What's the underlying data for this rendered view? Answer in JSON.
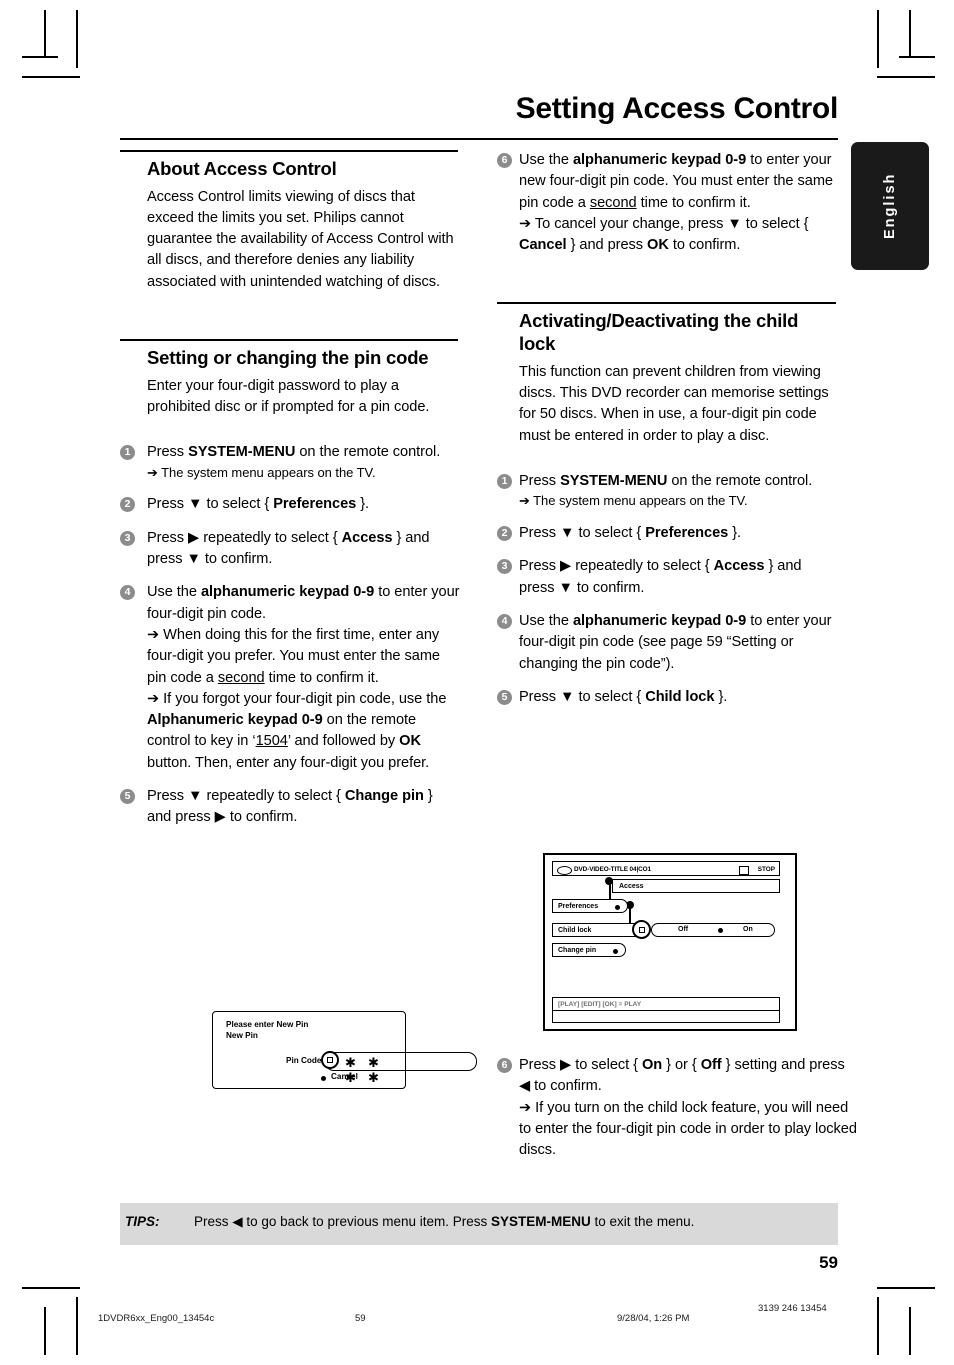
{
  "header": {
    "title": "Setting Access Control",
    "language_tab": "English"
  },
  "left_column": {
    "section1": {
      "heading": "About Access Control",
      "paragraph": "Access Control limits viewing of discs that exceed the limits you set.  Philips cannot guarantee the availability of Access Control with all discs, and therefore denies any liability associated with unintended watching of discs."
    },
    "section2": {
      "heading": "Setting or changing the pin code",
      "paragraph": "Enter your four-digit password to play a prohibited disc or if prompted for a pin code.",
      "steps": [
        {
          "num": "1",
          "main_pre": "Press ",
          "main_bold": "SYSTEM-MENU",
          "main_post": " on the remote control.",
          "sub": "➔ The system menu appears on the TV."
        },
        {
          "num": "2",
          "text_parts": [
            "Press ▼ to select { ",
            "Preferences",
            " }."
          ]
        },
        {
          "num": "3",
          "text_parts": [
            "Press ▶ repeatedly to select { ",
            "Access",
            " } and press ▼  to confirm."
          ]
        },
        {
          "num": "4",
          "main_pre": "Use the ",
          "main_bold": "alphanumeric keypad 0-9",
          "main_post": " to enter your four-digit pin code.",
          "sub1": "➔ When doing this for the first time, enter any four-digit you prefer. You must enter the same pin code a ",
          "sub1_underline": "second",
          "sub1_post": " time to confirm it.",
          "sub2_pre": "➔ If you forgot your four-digit pin code, use the ",
          "sub2_bold1": "Alphanumeric keypad 0-9",
          "sub2_mid": " on the remote control to key in ‘",
          "sub2_underline": "1504",
          "sub2_mid2": "’ and followed by ",
          "sub2_bold2": "OK",
          "sub2_post": " button.  Then, enter any four-digit you prefer."
        },
        {
          "num": "5",
          "text_parts": [
            "Press ▼ repeatedly to select { ",
            "Change pin",
            " } and press ▶  to confirm."
          ]
        }
      ]
    },
    "pin_figure": {
      "line1": "Please enter New Pin",
      "line2": "New Pin",
      "pin_code_label": "Pin Code",
      "stars": "✱ ✱ ✱ ✱",
      "cancel": "Cancel"
    }
  },
  "right_column": {
    "step6_pin": {
      "num": "6",
      "main_pre": "Use the ",
      "main_bold": "alphanumeric keypad 0-9",
      "main_post": " to enter your new four-digit pin code. You must enter the same pin code a ",
      "main_underline": "second",
      "main_post2": " time to confirm it.",
      "sub_pre": "➔ To cancel your change, press ▼ to select { ",
      "sub_bold1": "Cancel",
      "sub_mid": " } and press ",
      "sub_bold2": "OK",
      "sub_post": " to confirm."
    },
    "section3": {
      "heading": "Activating/Deactivating the child lock",
      "paragraph": "This function can prevent children from viewing discs.  This DVD recorder can memorise settings for 50 discs.  When in use, a four-digit pin code must be entered in order to play a disc.",
      "steps": [
        {
          "num": "1",
          "main_pre": "Press ",
          "main_bold": "SYSTEM-MENU",
          "main_post": " on the remote control.",
          "sub": "➔ The system menu appears on the TV."
        },
        {
          "num": "2",
          "text_parts": [
            "Press ▼ to select { ",
            "Preferences",
            " }."
          ]
        },
        {
          "num": "3",
          "text_parts": [
            "Press  ▶ repeatedly to select { ",
            "Access",
            " } and press ▼  to confirm."
          ]
        },
        {
          "num": "4",
          "main_pre": "Use the ",
          "main_bold": "alphanumeric keypad 0-9",
          "main_post": " to enter your four-digit pin code (see page 59 “Setting or changing the pin code”)."
        },
        {
          "num": "5",
          "text_parts": [
            "Press ▼ to select { ",
            "Child lock",
            " }."
          ]
        }
      ]
    },
    "tv_figure": {
      "title_text": "DVD-VIDEO-TITLE 04|CO1",
      "stop_text": "STOP",
      "access_label": "Access",
      "preferences_label": "Preferences",
      "child_lock_label": "Child lock",
      "change_pin_label": "Change pin",
      "off_label": "Off",
      "on_label": "On",
      "status_text": "[PLAY] [EDIT] [OK] = PLAY"
    },
    "step6_lock": {
      "num": "6",
      "pre": "Press ▶ to select { ",
      "bold1": "On",
      "mid": " } or { ",
      "bold2": "Off",
      "post": " } setting and press ◀  to confirm.",
      "sub": "➔ If you turn on the child lock feature, you will need to enter the four-digit pin code in order to play locked discs."
    }
  },
  "tips": {
    "label": "TIPS:",
    "text_pre": "Press ◀ to go back to previous menu item.  Press ",
    "text_bold": "SYSTEM-MENU",
    "text_post": " to exit the menu."
  },
  "page_number": "59",
  "print_footer": {
    "file": "1DVDR6xx_Eng00_13454c",
    "page": "59",
    "date": "9/28/04, 1:26 PM",
    "code": "3139 246 13454"
  }
}
